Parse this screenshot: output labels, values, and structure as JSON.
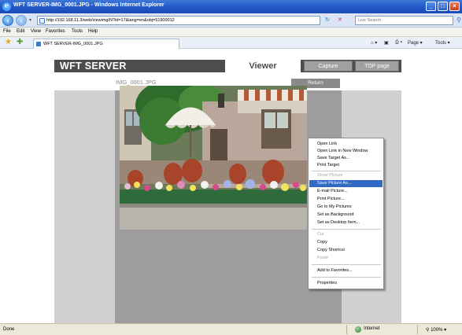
{
  "window": {
    "title": "WFT SERVER-IMG_0001.JPG - Windows Internet Explorer",
    "buttons": {
      "minimize": "_",
      "maximize": "□",
      "close": "×"
    }
  },
  "address_bar": {
    "url": "http://192.168.11.3/web/viewimg/N?id=17&lang=en&obj=51900012",
    "search_placeholder": "Live Search",
    "refresh_icon": "↻",
    "stop_icon": "✕"
  },
  "menu": [
    "File",
    "Edit",
    "View",
    "Favorites",
    "Tools",
    "Help"
  ],
  "tabbar": {
    "tab_label": "WFT SERVER-IMG_0001.JPG",
    "tools": [
      "Page ▾",
      "Tools ▾"
    ]
  },
  "page": {
    "brand": "WFT SERVER",
    "nav": {
      "viewer": "Viewer",
      "capture": "Capture",
      "top": "TOP page"
    },
    "filename": "IMG_0001.JPG",
    "return_label": "Return"
  },
  "context_menu": {
    "items": [
      {
        "label": "Open Link",
        "disabled": false
      },
      {
        "label": "Open Link in New Window",
        "disabled": false
      },
      {
        "label": "Save Target As...",
        "disabled": false
      },
      {
        "label": "Print Target",
        "disabled": false
      },
      {
        "label": "Show Picture",
        "disabled": true
      },
      {
        "label": "Save Picture As...",
        "disabled": false,
        "selected": true
      },
      {
        "label": "E-mail Picture...",
        "disabled": false
      },
      {
        "label": "Print Picture...",
        "disabled": false
      },
      {
        "label": "Go to My Pictures",
        "disabled": false
      },
      {
        "label": "Set as Background",
        "disabled": false
      },
      {
        "label": "Set as Desktop Item...",
        "disabled": false
      },
      {
        "label": "Cut",
        "disabled": true
      },
      {
        "label": "Copy",
        "disabled": false
      },
      {
        "label": "Copy Shortcut",
        "disabled": false
      },
      {
        "label": "Paste",
        "disabled": true
      },
      {
        "label": "Add to Favorites...",
        "disabled": false
      },
      {
        "label": "Properties",
        "disabled": false
      }
    ]
  },
  "statusbar": {
    "status": "Done",
    "zone": "Internet",
    "zoom": "100%"
  },
  "colors": {
    "titlebar": "#1f55c4",
    "header_bg": "#4d4d4d",
    "menu_highlight": "#316ac5"
  }
}
